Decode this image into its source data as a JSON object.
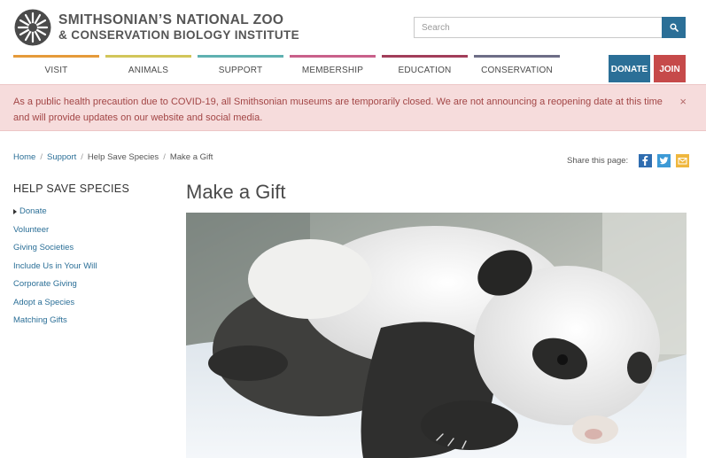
{
  "header": {
    "logo_line1": "SMITHSONIAN’S NATIONAL ZOO",
    "logo_line2": "& CONSERVATION BIOLOGY INSTITUTE",
    "logo_icon": "sunburst-logo-icon"
  },
  "search": {
    "placeholder": "Search",
    "button_icon": "search-icon"
  },
  "nav": {
    "items": [
      {
        "label": "VISIT",
        "color": "#e59a3a"
      },
      {
        "label": "ANIMALS",
        "color": "#d2c65a"
      },
      {
        "label": "SUPPORT",
        "color": "#5fb1b1"
      },
      {
        "label": "MEMBERSHIP",
        "color": "#c9608a"
      },
      {
        "label": "EDUCATION",
        "color": "#a23e5a"
      },
      {
        "label": "CONSERVATION",
        "color": "#6e6e86"
      }
    ],
    "donate_label": "DONATE",
    "join_label": "JOIN"
  },
  "alert": {
    "text": "As a public health precaution due to COVID-19, all Smithsonian museums are temporarily closed. We are not announcing a reopening date at this time and will provide updates on our website and social media.",
    "close": "×"
  },
  "breadcrumb": {
    "items": [
      "Home",
      "Support",
      "Help Save Species"
    ],
    "separator": "/",
    "current": "Make a Gift"
  },
  "share": {
    "label": "Share this page:",
    "icons": [
      "facebook-icon",
      "twitter-icon",
      "email-icon"
    ]
  },
  "sidebar": {
    "title": "HELP SAVE SPECIES",
    "items": [
      {
        "label": "Donate",
        "active": true
      },
      {
        "label": "Volunteer"
      },
      {
        "label": "Giving Societies"
      },
      {
        "label": "Include Us in Your Will"
      },
      {
        "label": "Corporate Giving"
      },
      {
        "label": "Adopt a Species"
      },
      {
        "label": "Matching Gifts"
      }
    ]
  },
  "main": {
    "title": "Make a Gift",
    "hero_image": "giant-panda-cub-photo"
  },
  "colors": {
    "brand_blue": "#2b6f97",
    "join_red": "#c64a4a",
    "alert_bg": "#f6dcdc",
    "alert_text": "#a24545"
  }
}
